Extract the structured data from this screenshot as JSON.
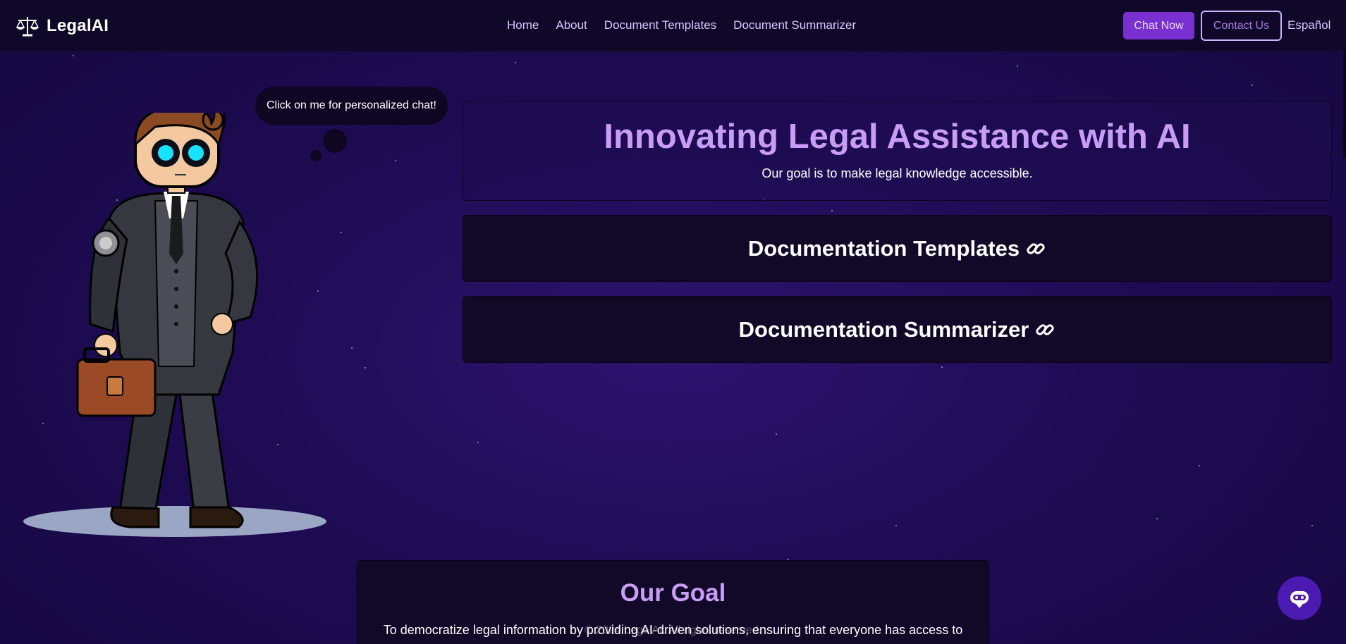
{
  "nav": {
    "brand": "LegalAI",
    "links": [
      "Home",
      "About",
      "Document Templates",
      "Document Summarizer"
    ],
    "chat_button": "Chat Now",
    "contact_button": "Contact Us",
    "language": "Español"
  },
  "robot": {
    "bubble_text": "Click on me for personalized chat!"
  },
  "hero": {
    "title": "Innovating Legal Assistance with AI",
    "subtitle": "Our goal is to make legal knowledge accessible."
  },
  "cards": {
    "templates": "Documentation Templates",
    "summarizer": "Documentation Summarizer"
  },
  "goal": {
    "title": "Our Goal",
    "text": "To democratize legal information by providing AI-driven solutions, ensuring that everyone has access to"
  },
  "footer": {
    "text": "© 2024 LegalAI. All rights reserved."
  },
  "colors": {
    "accent": "#c99df5",
    "chat_button": "#7a2fd0",
    "nav_bg": "#100828"
  }
}
